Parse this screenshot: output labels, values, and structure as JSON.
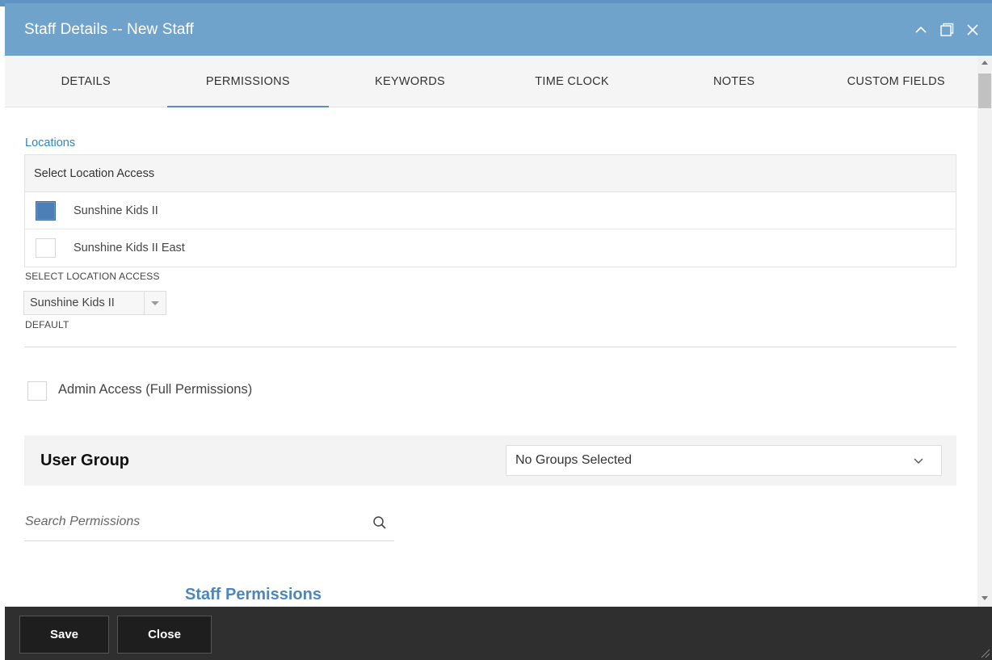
{
  "window": {
    "title": "Staff Details -- New Staff"
  },
  "tabs": [
    {
      "label": "DETAILS",
      "active": false
    },
    {
      "label": "PERMISSIONS",
      "active": true
    },
    {
      "label": "KEYWORDS",
      "active": false
    },
    {
      "label": "TIME CLOCK",
      "active": false
    },
    {
      "label": "NOTES",
      "active": false
    },
    {
      "label": "CUSTOM FIELDS",
      "active": false
    }
  ],
  "locations": {
    "heading": "Locations",
    "table_header": "Select Location Access",
    "items": [
      {
        "label": "Sunshine Kids II",
        "checked": true
      },
      {
        "label": "Sunshine Kids II East",
        "checked": false
      }
    ],
    "select_caption": "SELECT LOCATION ACCESS",
    "default_value": "Sunshine Kids II",
    "default_caption": "DEFAULT"
  },
  "admin": {
    "label": "Admin Access (Full Permissions)",
    "checked": false
  },
  "user_group": {
    "title": "User Group",
    "selected": "No Groups Selected"
  },
  "search": {
    "placeholder": "Search Permissions"
  },
  "staff_permissions": {
    "heading": "Staff Permissions"
  },
  "footer": {
    "save_label": "Save",
    "close_label": "Close"
  },
  "colors": {
    "titlebar": "#6fa3cc",
    "accent": "#4f86ba",
    "link": "#2f86c6",
    "footer": "#2f2f2f"
  }
}
